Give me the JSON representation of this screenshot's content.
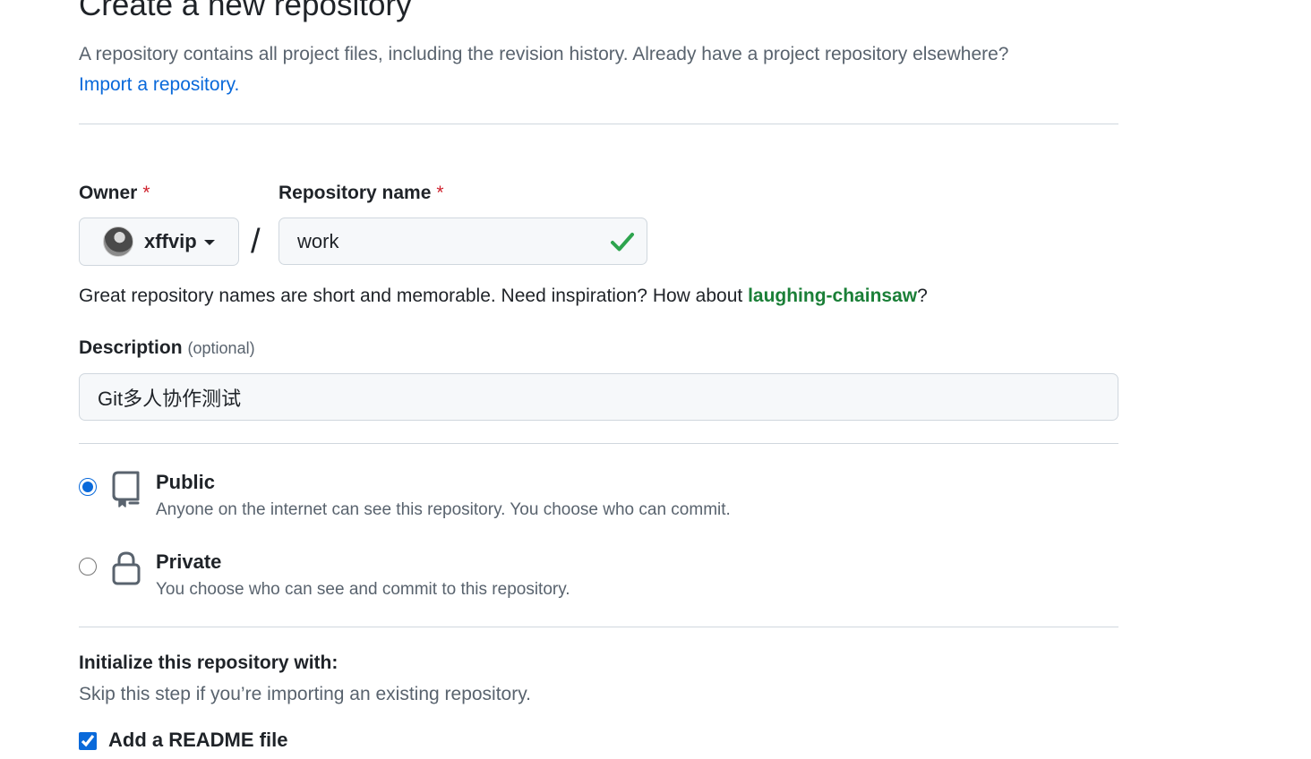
{
  "header": {
    "title": "Create a new repository",
    "subtitle": "A repository contains all project files, including the revision history. Already have a project repository elsewhere?",
    "import_link": "Import a repository."
  },
  "owner": {
    "label": "Owner",
    "required_mark": "*",
    "value": "xffvip"
  },
  "repo_name": {
    "label": "Repository name",
    "required_mark": "*",
    "value": "work",
    "separator": "/"
  },
  "hint": {
    "text": "Great repository names are short and memorable. Need inspiration? How about ",
    "suggestion": "laughing-chainsaw",
    "suffix": "?"
  },
  "description": {
    "label": "Description",
    "optional": "(optional)",
    "value": "Git多人协作测试"
  },
  "visibility": {
    "public": {
      "title": "Public",
      "desc": "Anyone on the internet can see this repository. You choose who can commit.",
      "selected": true
    },
    "private": {
      "title": "Private",
      "desc": "You choose who can see and commit to this repository.",
      "selected": false
    }
  },
  "initialize": {
    "title": "Initialize this repository with:",
    "desc": "Skip this step if you’re importing an existing repository.",
    "readme_label": "Add a README file",
    "readme_checked": true
  },
  "colors": {
    "link": "#0969da",
    "success": "#1a7f37",
    "required": "#cf222e",
    "check": "#2da44e"
  }
}
